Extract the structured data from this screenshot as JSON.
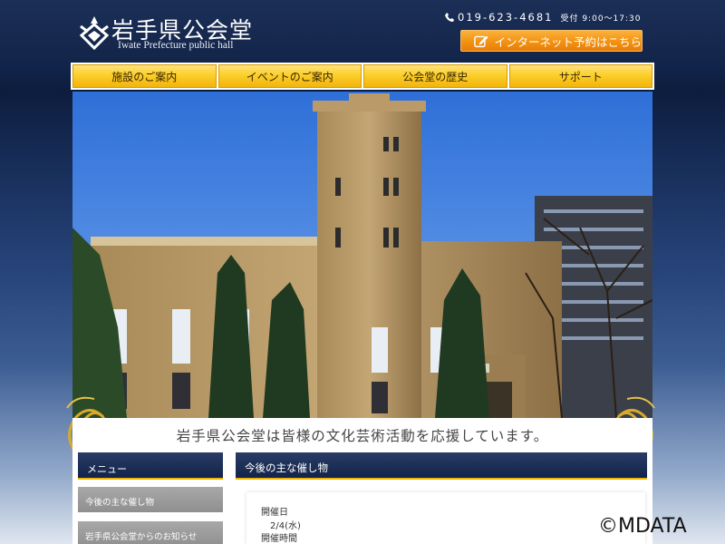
{
  "header": {
    "title": "岩手県公会堂",
    "subtitle": "Iwate Prefecture public hall",
    "phone": "019-623-4681",
    "hours": "受付 9:00〜17:30",
    "reserve_label": "インターネット予約はこちら"
  },
  "nav": {
    "items": [
      {
        "label": "施設のご案内"
      },
      {
        "label": "イベントのご案内"
      },
      {
        "label": "公会堂の歴史"
      },
      {
        "label": "サポート"
      }
    ]
  },
  "tagline": "岩手県公会堂は皆様の文化芸術活動を応援しています。",
  "sidebar": {
    "title": "メニュー",
    "items": [
      {
        "label": "今後の主な催し物"
      },
      {
        "label": "岩手県公会堂からのお知らせ"
      }
    ]
  },
  "events": {
    "title": "今後の主な催し物",
    "date_label": "開催日",
    "date_value": "2/4(水)",
    "time_label": "開催時間"
  },
  "watermark": "©MDATA",
  "colors": {
    "header_bg": "#14254a",
    "nav_gold": "#fbcf2a",
    "reserve_orange": "#f29211",
    "panel_navy": "#13244a",
    "menu_gray": "#999999"
  },
  "icons": [
    "logo-emblem-icon",
    "phone-icon",
    "pen-icon",
    "ornament-icon"
  ]
}
